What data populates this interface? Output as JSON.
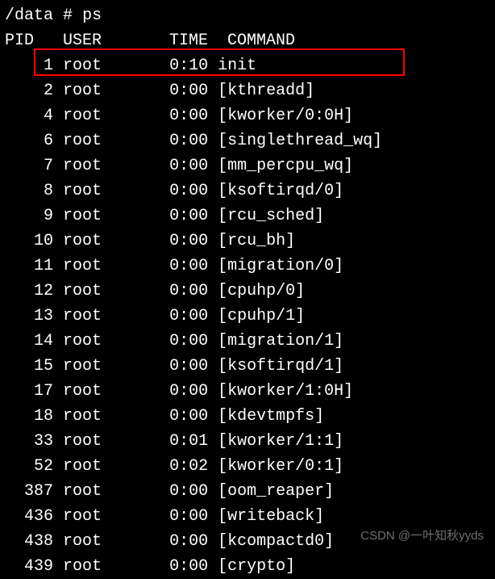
{
  "prompt": {
    "path": "/data",
    "symbol": "#",
    "command": "ps"
  },
  "header": {
    "pid": "PID",
    "user": "USER",
    "time": "TIME",
    "command": "COMMAND"
  },
  "rows": [
    {
      "pid": "1",
      "user": "root",
      "time": "0:10",
      "command": "init"
    },
    {
      "pid": "2",
      "user": "root",
      "time": "0:00",
      "command": "[kthreadd]"
    },
    {
      "pid": "4",
      "user": "root",
      "time": "0:00",
      "command": "[kworker/0:0H]"
    },
    {
      "pid": "6",
      "user": "root",
      "time": "0:00",
      "command": "[singlethread_wq]"
    },
    {
      "pid": "7",
      "user": "root",
      "time": "0:00",
      "command": "[mm_percpu_wq]"
    },
    {
      "pid": "8",
      "user": "root",
      "time": "0:00",
      "command": "[ksoftirqd/0]"
    },
    {
      "pid": "9",
      "user": "root",
      "time": "0:00",
      "command": "[rcu_sched]"
    },
    {
      "pid": "10",
      "user": "root",
      "time": "0:00",
      "command": "[rcu_bh]"
    },
    {
      "pid": "11",
      "user": "root",
      "time": "0:00",
      "command": "[migration/0]"
    },
    {
      "pid": "12",
      "user": "root",
      "time": "0:00",
      "command": "[cpuhp/0]"
    },
    {
      "pid": "13",
      "user": "root",
      "time": "0:00",
      "command": "[cpuhp/1]"
    },
    {
      "pid": "14",
      "user": "root",
      "time": "0:00",
      "command": "[migration/1]"
    },
    {
      "pid": "15",
      "user": "root",
      "time": "0:00",
      "command": "[ksoftirqd/1]"
    },
    {
      "pid": "17",
      "user": "root",
      "time": "0:00",
      "command": "[kworker/1:0H]"
    },
    {
      "pid": "18",
      "user": "root",
      "time": "0:00",
      "command": "[kdevtmpfs]"
    },
    {
      "pid": "33",
      "user": "root",
      "time": "0:01",
      "command": "[kworker/1:1]"
    },
    {
      "pid": "52",
      "user": "root",
      "time": "0:02",
      "command": "[kworker/0:1]"
    },
    {
      "pid": "387",
      "user": "root",
      "time": "0:00",
      "command": "[oom_reaper]"
    },
    {
      "pid": "436",
      "user": "root",
      "time": "0:00",
      "command": "[writeback]"
    },
    {
      "pid": "438",
      "user": "root",
      "time": "0:00",
      "command": "[kcompactd0]"
    },
    {
      "pid": "439",
      "user": "root",
      "time": "0:00",
      "command": "[crypto]"
    }
  ],
  "highlight_row_index": 1,
  "watermark": "CSDN @一叶知秋yyds"
}
